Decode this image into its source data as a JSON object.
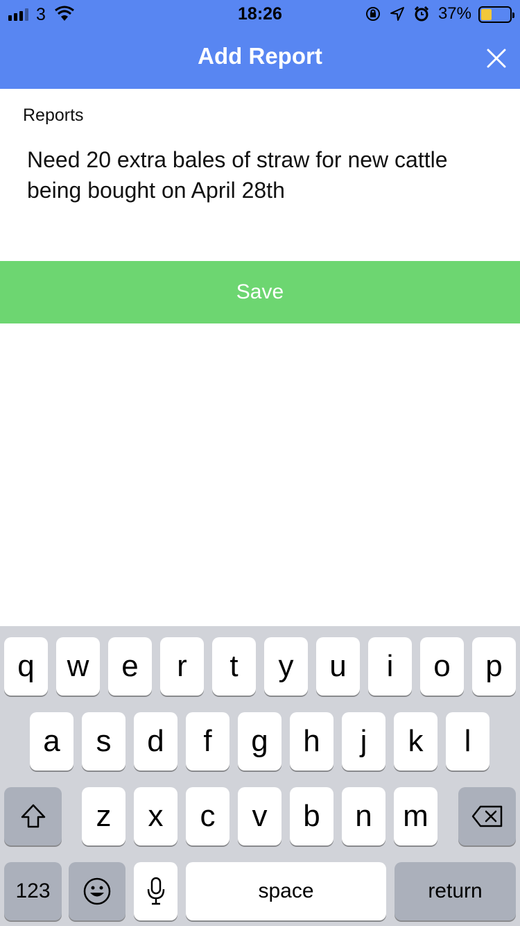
{
  "status_bar": {
    "carrier": "3",
    "time": "18:26",
    "battery_percent": "37%",
    "battery_level": 0.37,
    "icons": [
      "signal-icon",
      "wifi-icon",
      "orientation-lock-icon",
      "location-icon",
      "alarm-icon",
      "battery-icon"
    ]
  },
  "header": {
    "title": "Add Report",
    "close_icon": "close-icon",
    "color": "#5886f2"
  },
  "form": {
    "label": "Reports",
    "value": "Need 20 extra bales of straw for new cattle being bought on April 28th"
  },
  "save_button": {
    "label": "Save",
    "color": "#6dd671"
  },
  "keyboard": {
    "row1": [
      "q",
      "w",
      "e",
      "r",
      "t",
      "y",
      "u",
      "i",
      "o",
      "p"
    ],
    "row2": [
      "a",
      "s",
      "d",
      "f",
      "g",
      "h",
      "j",
      "k",
      "l"
    ],
    "row3": [
      "z",
      "x",
      "c",
      "v",
      "b",
      "n",
      "m"
    ],
    "numbers_label": "123",
    "space_label": "space",
    "return_label": "return",
    "icons": [
      "shift-icon",
      "backspace-icon",
      "emoji-icon",
      "microphone-icon"
    ]
  }
}
